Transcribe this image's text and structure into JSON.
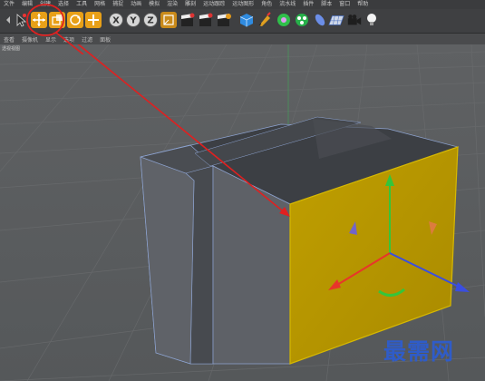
{
  "menu": [
    "文件",
    "编辑",
    "创建",
    "选择",
    "工具",
    "网格",
    "捕捉",
    "动画",
    "模拟",
    "渲染",
    "雕刻",
    "运动跟踪",
    "运动图形",
    "角色",
    "流水线",
    "插件",
    "脚本",
    "窗口",
    "帮助"
  ],
  "viewport_menu": [
    "查看",
    "摄像机",
    "显示",
    "选项",
    "过滤",
    "面板"
  ],
  "viewport_label": "透视视图",
  "toolbar": {
    "undo_icon": "undo-arrow-icon",
    "select_tool": "cursor-arrow-icon",
    "move_tool": "move-tool-icon",
    "scale_tool": "scale-tool-icon",
    "rotate_tool": "rotate-tool-icon",
    "live_select": "plus-cross-icon",
    "axis_x": "X",
    "axis_y": "Y",
    "axis_z": "Z",
    "world_coord": "world-coordinate-icon",
    "render_view": "clapper-icon",
    "render_to_picture": "clapper-icon",
    "render_settings": "render-settings-icon",
    "cube": "cube-icon",
    "pen": "pen-icon",
    "subdivision": "subdivision-icon",
    "cloner": "cloner-icon",
    "deformer": "deformer-icon",
    "floor": "floor-icon",
    "camera": "camera-icon",
    "light": "light-bulb-icon"
  },
  "colors": {
    "highlight_ring": "#e02020",
    "selected_face": "#b89a00",
    "axis_x": "#e8352a",
    "axis_y": "#35c53a",
    "axis_z": "#3a4ee0",
    "watermark": "#2f5cc8"
  },
  "watermark": "最需网"
}
